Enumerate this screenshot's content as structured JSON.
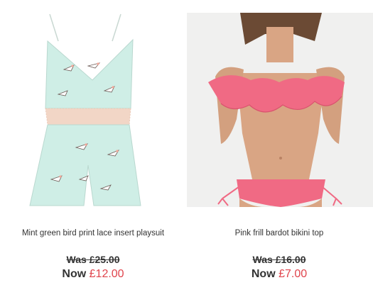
{
  "products": [
    {
      "title": "Mint green bird print lace insert playsuit",
      "was_label": "Was",
      "was_price": "£25.00",
      "now_label": "Now",
      "now_price": "£12.00",
      "image_icon": "playsuit-image",
      "colors": {
        "fabric": "#cfeee6",
        "lace": "#f2d6c6"
      }
    },
    {
      "title": "Pink frill bardot bikini top",
      "was_label": "Was",
      "was_price": "£16.00",
      "now_label": "Now",
      "now_price": "£7.00",
      "image_icon": "bikini-image",
      "colors": {
        "bikini": "#f06a84",
        "skin": "#d9a584"
      }
    }
  ],
  "colors": {
    "sale_price": "#e0444c",
    "text": "#333333"
  }
}
